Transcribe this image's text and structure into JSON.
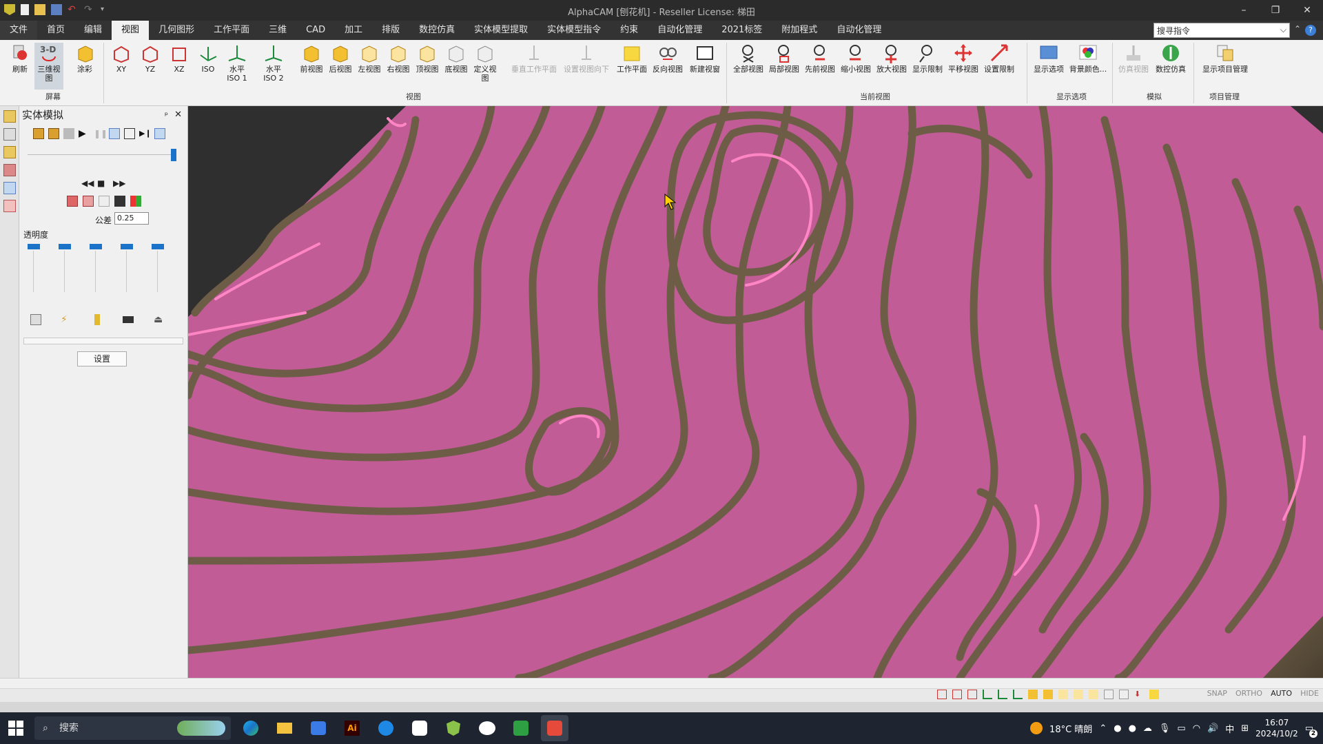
{
  "titlebar": {
    "title": "AlphaCAM [刨花机] - Reseller License: 梯田",
    "minimize": "–",
    "restore": "❐",
    "close": "✕"
  },
  "menu": [
    "文件",
    "首页",
    "编辑",
    "视图",
    "几何图形",
    "工作平面",
    "三维",
    "CAD",
    "加工",
    "排版",
    "数控仿真",
    "实体模型提取",
    "实体模型指令",
    "约束",
    "自动化管理",
    "2021标签",
    "附加程式",
    "自动化管理"
  ],
  "search": {
    "placeholder": "搜寻指令"
  },
  "ribbon": {
    "screen": {
      "group": "屏幕",
      "buttons": [
        "刷新",
        "三维视图",
        "涂彩"
      ]
    },
    "view": {
      "group": "视图",
      "buttons": [
        "XY",
        "YZ",
        "XZ",
        "ISO",
        "水平 ISO 1",
        "水平 ISO 2",
        "前视图",
        "后视图",
        "左视图",
        "右视图",
        "顶视图",
        "底视图",
        "定义视图",
        "垂直工作平面",
        "设置视图向下",
        "工作平面",
        "反向视图",
        "新建视窗"
      ]
    },
    "current": {
      "group": "当前视图",
      "buttons": [
        "全部视图",
        "局部视图",
        "先前视图",
        "缩小视图",
        "放大视图",
        "显示限制",
        "平移视图",
        "设置限制"
      ]
    },
    "display": {
      "group": "显示选项",
      "buttons": [
        "显示选项",
        "背景颜色..."
      ]
    },
    "sim": {
      "group": "模拟",
      "buttons": [
        "仿真视图",
        "数控仿真"
      ]
    },
    "project": {
      "group": "项目管理",
      "buttons": [
        "显示项目管理"
      ]
    }
  },
  "panel": {
    "title": "实体模拟",
    "pin": "ᵖ",
    "close": "✕",
    "tolerance_label": "公差",
    "tolerance_value": "0.25",
    "transparency_label": "透明度",
    "settings_button": "设置"
  },
  "statusbar": {
    "modes": [
      "SNAP",
      "ORTHO",
      "AUTO",
      "HIDE"
    ]
  },
  "taskbar": {
    "search_placeholder": "搜索",
    "weather": "18°C 晴朗",
    "ime": "中",
    "time": "16:07",
    "date": "2024/10/2",
    "notif_count": "2"
  },
  "colors": {
    "surface": "#c15c96",
    "groove": "#6e5d46",
    "edge": "#ff86c4",
    "background": "#2f2f2f",
    "accent": "#1a73c8"
  }
}
